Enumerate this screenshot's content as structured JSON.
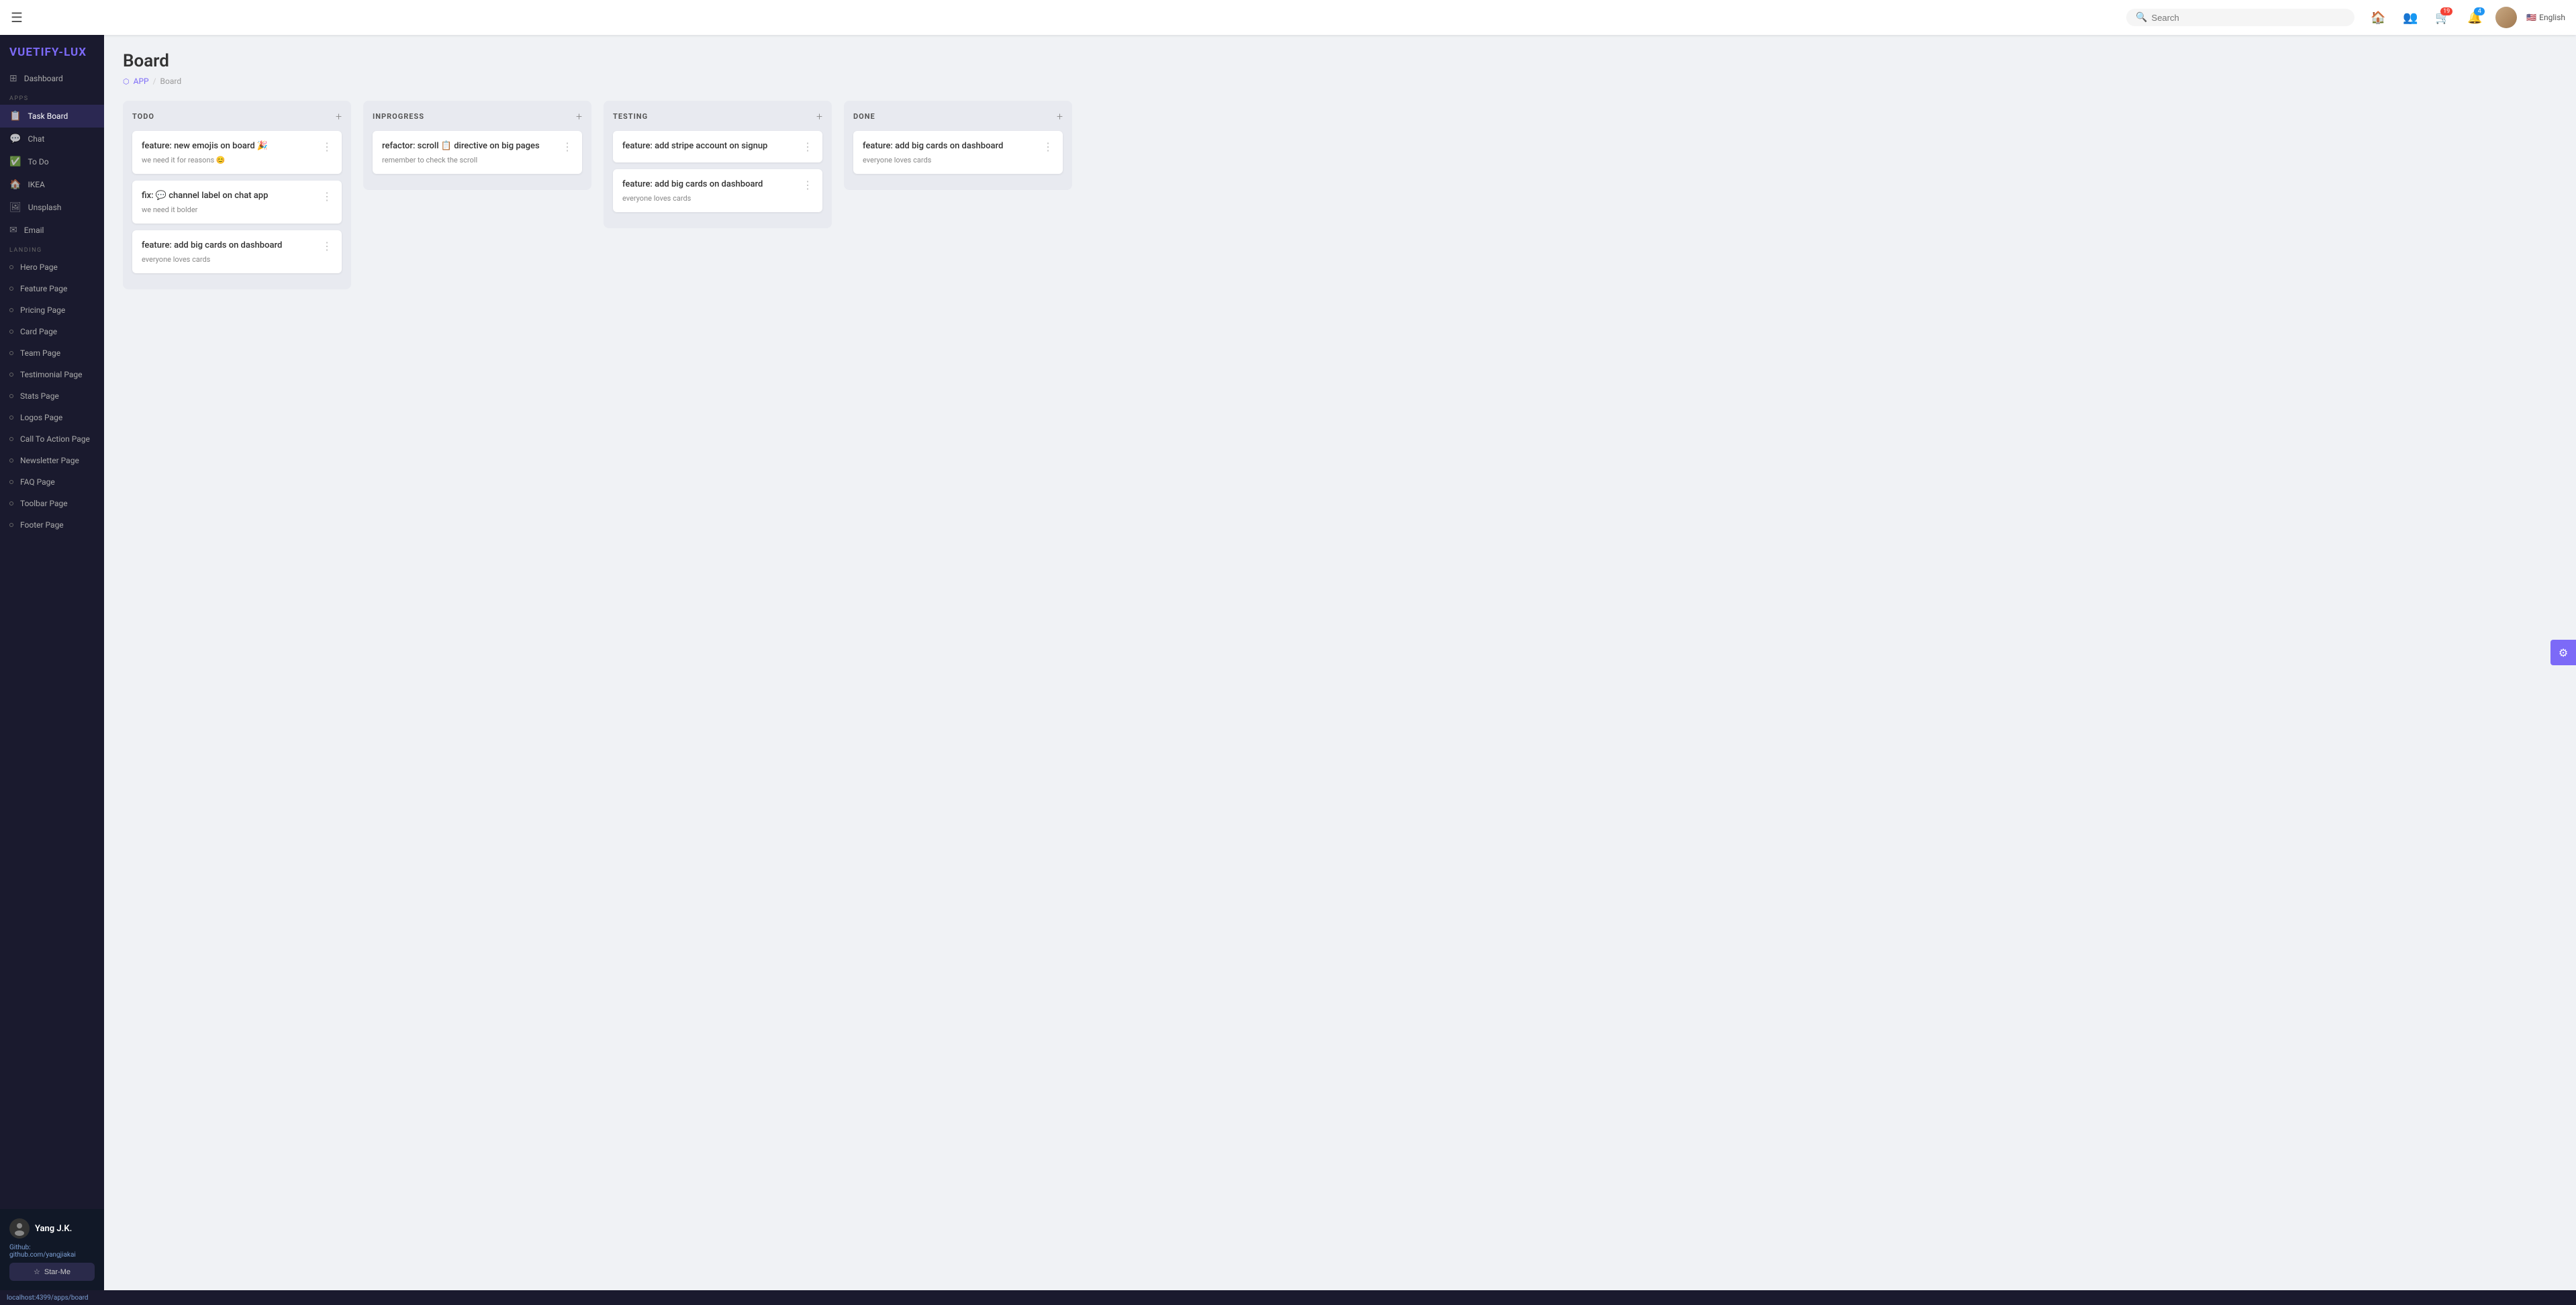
{
  "app": {
    "logo_prefix": "VUETIFY",
    "logo_suffix": "-LUX"
  },
  "topbar": {
    "menu_icon": "☰",
    "search_placeholder": "Search",
    "icons": [
      {
        "name": "home-icon",
        "symbol": "🏠",
        "badge": null
      },
      {
        "name": "users-icon",
        "symbol": "👥",
        "badge": null
      },
      {
        "name": "cart-icon",
        "symbol": "🛒",
        "badge": "19",
        "badge_color": "red"
      },
      {
        "name": "bell-icon",
        "symbol": "🔔",
        "badge": "4",
        "badge_color": "blue"
      }
    ],
    "avatar_initial": "👤",
    "language": "English",
    "flag": "🇺🇸"
  },
  "sidebar": {
    "dashboard_label": "Dashboard",
    "apps_section": "APPS",
    "apps_items": [
      {
        "label": "Task Board",
        "icon": "📋",
        "active": true
      },
      {
        "label": "Chat",
        "icon": "💬"
      },
      {
        "label": "To Do",
        "icon": "✅"
      },
      {
        "label": "IKEA",
        "icon": "🏠"
      },
      {
        "label": "Unsplash",
        "icon": "🖼"
      },
      {
        "label": "Email",
        "icon": "✉"
      }
    ],
    "landing_section": "LANDING",
    "landing_items": [
      "Hero Page",
      "Feature Page",
      "Pricing Page",
      "Card Page",
      "Team Page",
      "Testimonial Page",
      "Stats Page",
      "Logos Page",
      "Call To Action Page",
      "Newsletter Page",
      "FAQ Page",
      "Toolbar Page",
      "Footer Page"
    ],
    "footer": {
      "avatar": "⭕",
      "name": "Yang J.K.",
      "github_label": "Github:",
      "github_url": "github.com/yangjiakai",
      "star_label": "Star-Me"
    }
  },
  "main": {
    "page_title": "Board",
    "breadcrumb": [
      "APP",
      "Board"
    ],
    "columns": [
      {
        "id": "todo",
        "title": "TODO",
        "cards": [
          {
            "title": "feature: new emojis on board 🎉",
            "subtitle": "we need it for reasons 😊"
          },
          {
            "title": "fix: 💬 channel label on chat app",
            "subtitle": "we need it bolder"
          },
          {
            "title": "feature: add big cards on dashboard",
            "subtitle": "everyone loves cards"
          }
        ]
      },
      {
        "id": "inprogress",
        "title": "INPROGRESS",
        "cards": [
          {
            "title": "refactor: scroll 📋 directive on big pages",
            "subtitle": "remember to check the scroll"
          }
        ]
      },
      {
        "id": "testing",
        "title": "TESTING",
        "cards": [
          {
            "title": "feature: add stripe account on signup",
            "subtitle": ""
          },
          {
            "title": "feature: add big cards on dashboard",
            "subtitle": "everyone loves cards"
          }
        ]
      },
      {
        "id": "done",
        "title": "DONE",
        "cards": [
          {
            "title": "feature: add big cards on dashboard",
            "subtitle": "everyone loves cards"
          }
        ]
      }
    ]
  },
  "statusbar": {
    "url": "localhost:4399/apps/board"
  }
}
